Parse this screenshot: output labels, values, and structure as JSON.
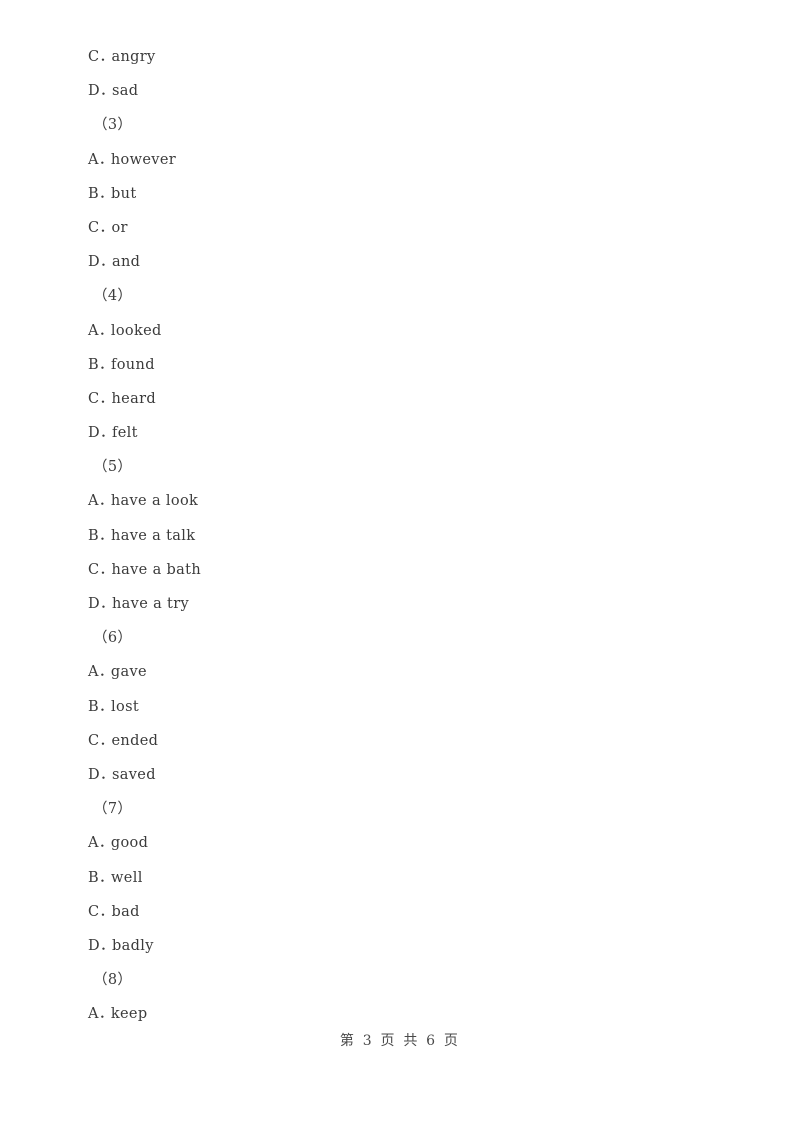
{
  "document": {
    "background_color": "#ffffff",
    "text_color": "#3b3b3b"
  },
  "content_lines": [
    {
      "kind": "option",
      "letter": "C",
      "separator": "．",
      "text": "angry"
    },
    {
      "kind": "option",
      "letter": "D",
      "separator": "．",
      "text": "sad"
    },
    {
      "kind": "question",
      "label": "（3）"
    },
    {
      "kind": "option",
      "letter": "A",
      "separator": "．",
      "text": "however"
    },
    {
      "kind": "option",
      "letter": "B",
      "separator": "．",
      "text": "but"
    },
    {
      "kind": "option",
      "letter": "C",
      "separator": "．",
      "text": "or"
    },
    {
      "kind": "option",
      "letter": "D",
      "separator": "．",
      "text": "and"
    },
    {
      "kind": "question",
      "label": "（4）"
    },
    {
      "kind": "option",
      "letter": "A",
      "separator": "．",
      "text": "looked"
    },
    {
      "kind": "option",
      "letter": "B",
      "separator": "．",
      "text": "found"
    },
    {
      "kind": "option",
      "letter": "C",
      "separator": "．",
      "text": "heard"
    },
    {
      "kind": "option",
      "letter": "D",
      "separator": "．",
      "text": "felt"
    },
    {
      "kind": "question",
      "label": "（5）"
    },
    {
      "kind": "option",
      "letter": "A",
      "separator": "．",
      "text": "have a look"
    },
    {
      "kind": "option",
      "letter": "B",
      "separator": "．",
      "text": "have a talk"
    },
    {
      "kind": "option",
      "letter": "C",
      "separator": "．",
      "text": "have a bath"
    },
    {
      "kind": "option",
      "letter": "D",
      "separator": "．",
      "text": "have a try"
    },
    {
      "kind": "question",
      "label": "（6）"
    },
    {
      "kind": "option",
      "letter": "A",
      "separator": "．",
      "text": "gave"
    },
    {
      "kind": "option",
      "letter": "B",
      "separator": "．",
      "text": "lost"
    },
    {
      "kind": "option",
      "letter": "C",
      "separator": "．",
      "text": "ended"
    },
    {
      "kind": "option",
      "letter": "D",
      "separator": "．",
      "text": "saved"
    },
    {
      "kind": "question",
      "label": "（7）"
    },
    {
      "kind": "option",
      "letter": "A",
      "separator": "．",
      "text": "good"
    },
    {
      "kind": "option",
      "letter": "B",
      "separator": "．",
      "text": "well"
    },
    {
      "kind": "option",
      "letter": "C",
      "separator": "．",
      "text": "bad"
    },
    {
      "kind": "option",
      "letter": "D",
      "separator": "．",
      "text": "badly"
    },
    {
      "kind": "question",
      "label": "（8）"
    },
    {
      "kind": "option",
      "letter": "A",
      "separator": "．",
      "text": "keep"
    }
  ],
  "footer": {
    "text": "第 3 页 共 6 页",
    "current_page": 3,
    "total_pages": 6
  }
}
